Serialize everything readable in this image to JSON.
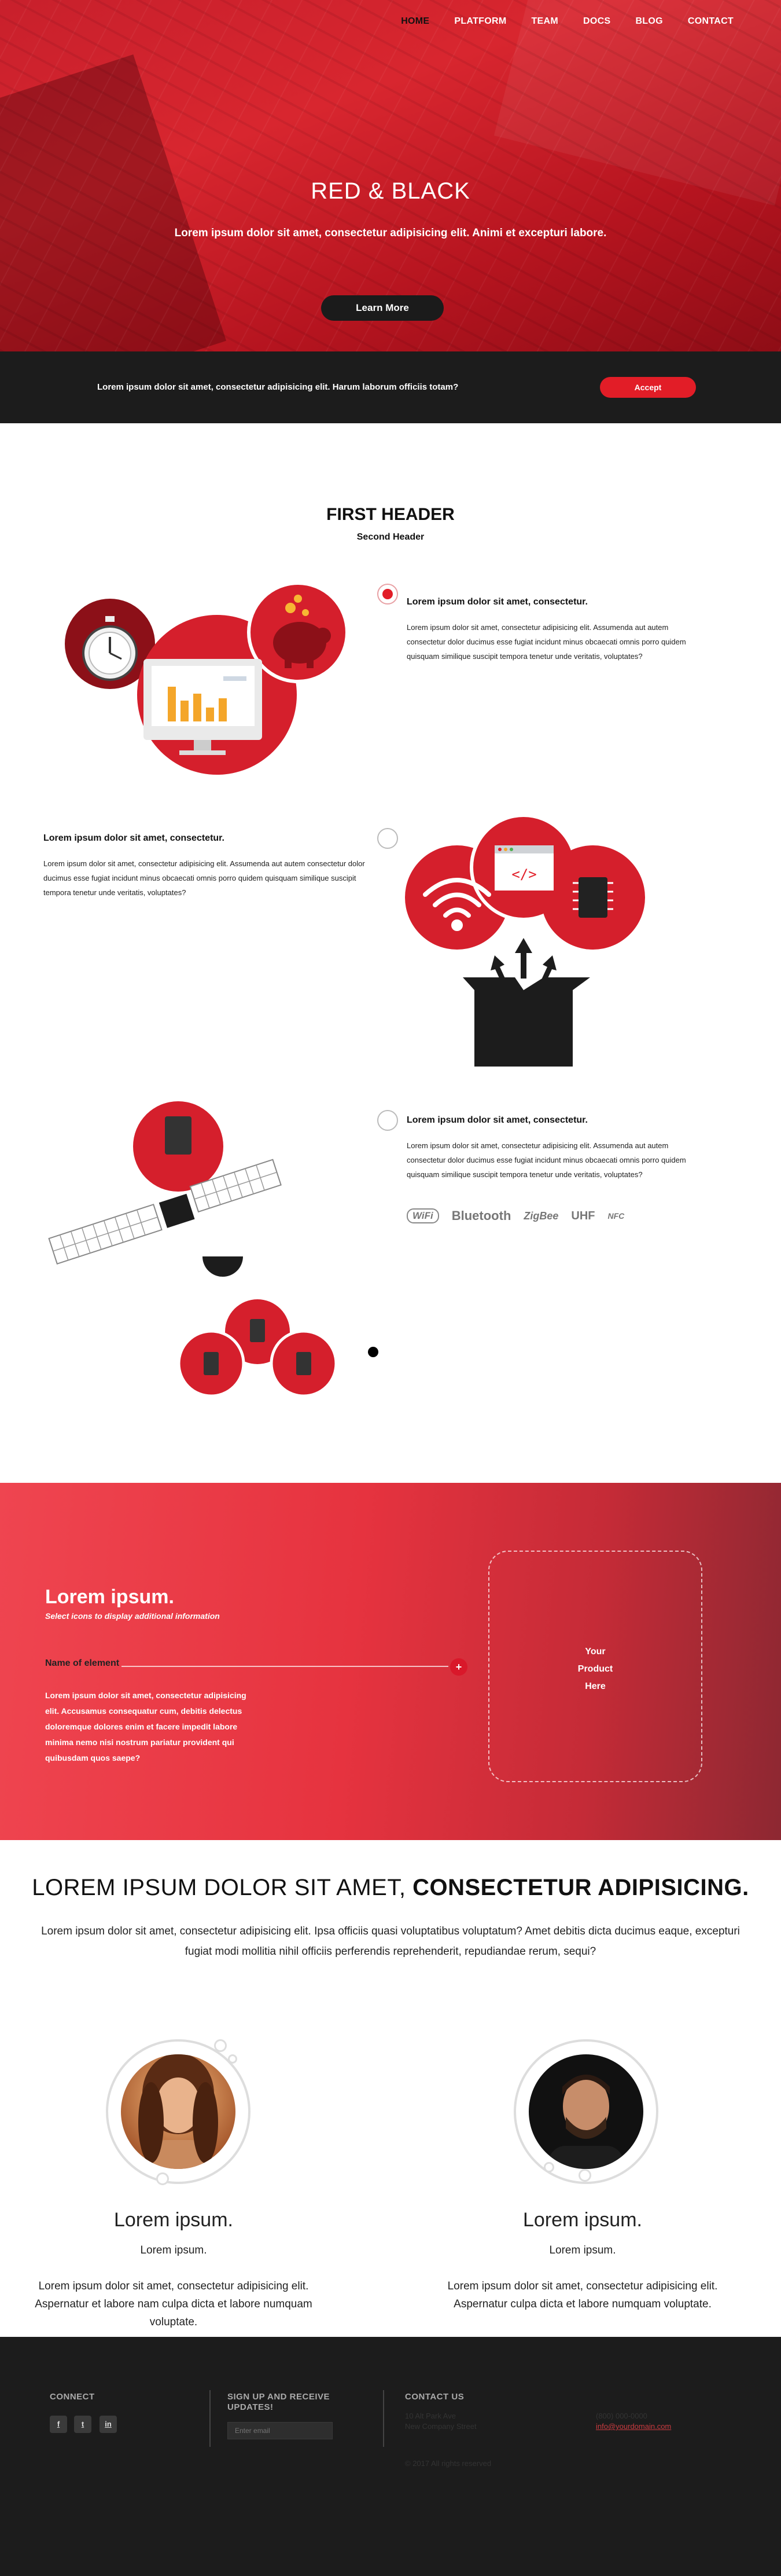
{
  "nav": {
    "items": [
      "HOME",
      "PLATFORM",
      "TEAM",
      "DOCS",
      "BLOG",
      "CONTACT"
    ],
    "active": "HOME"
  },
  "hero": {
    "title": "RED & BLACK",
    "subtitle": "Lorem ipsum dolor sit amet, consectetur adipisicing elit. Animi et excepturi labore.",
    "cta": "Learn More"
  },
  "cookie": {
    "text": "Lorem ipsum dolor sit amet, consectetur adipisicing elit. Harum laborum officiis totam?",
    "accept": "Accept"
  },
  "features": {
    "header": "FIRST HEADER",
    "subheader": "Second Header",
    "items": [
      {
        "title": "Lorem ipsum dolor sit amet, consectetur.",
        "text": "Lorem ipsum dolor sit amet, consectetur adipisicing elit. Assumenda aut autem consectetur dolor ducimus esse fugiat incidunt minus obcaecati omnis porro quidem quisquam similique suscipit tempora tenetur unde veritatis, voluptates?"
      },
      {
        "title": "Lorem ipsum dolor sit amet, consectetur.",
        "text": "Lorem ipsum dolor sit amet, consectetur adipisicing elit. Assumenda aut autem consectetur dolor ducimus esse fugiat incidunt minus obcaecati omnis porro quidem quisquam similique suscipit tempora tenetur unde veritatis, voluptates?"
      },
      {
        "title": "Lorem ipsum dolor sit amet, consectetur.",
        "text": "Lorem ipsum dolor sit amet, consectetur adipisicing elit. Assumenda aut autem consectetur dolor ducimus esse fugiat incidunt minus obcaecati omnis porro quidem quisquam similique suscipit tempora tenetur unde veritatis, voluptates?"
      }
    ],
    "tech_logos": [
      "WiFi",
      "Bluetooth",
      "ZigBee",
      "UHF",
      "NFC"
    ]
  },
  "promo": {
    "title": "Lorem ipsum.",
    "subtitle": "Select icons to display additional information",
    "element_name": "Name of element",
    "plus": "+",
    "description": "Lorem ipsum dolor sit amet, consectetur adipisicing elit. Accusamus consequatur cum, debitis delectus doloremque dolores enim et facere impedit labore minima nemo nisi nostrum pariatur provident qui quibusdam quos saepe?",
    "product_placeholder": "Your\nProduct\nHere"
  },
  "about": {
    "heading_light": "LOREM IPSUM DOLOR SIT AMET, ",
    "heading_bold": "CONSECTETUR ADIPISICING.",
    "text": "Lorem ipsum dolor sit amet, consectetur adipisicing elit. Ipsa officiis quasi voluptatibus voluptatum? Amet debitis dicta ducimus eaque, excepturi fugiat modi mollitia nihil officiis perferendis reprehenderit, repudiandae rerum, sequi?"
  },
  "team": [
    {
      "name": "Lorem ipsum.",
      "role": "Lorem ipsum.",
      "bio": "Lorem ipsum dolor sit amet, consectetur adipisicing elit. Aspernatur et labore nam culpa dicta et labore numquam voluptate."
    },
    {
      "name": "Lorem ipsum.",
      "role": "Lorem ipsum.",
      "bio": "Lorem ipsum dolor sit amet, consectetur adipisicing elit. Aspernatur culpa dicta et labore numquam voluptate."
    }
  ],
  "footer": {
    "connect": "CONNECT",
    "social": [
      "f",
      "t",
      "in"
    ],
    "signup": "SIGN UP AND RECEIVE UPDATES!",
    "email_placeholder": "Enter email",
    "contact": "CONTACT US",
    "address": "10 Alt Park Ave\nNew Company Street",
    "copyright": "© 2017 All rights reserved",
    "phone": "(800) 000-0000",
    "email": "info@yourdomain.com"
  },
  "colors": {
    "accent": "#e21d27",
    "dark": "#1c1c1c",
    "promo_red": "#e6333f"
  }
}
